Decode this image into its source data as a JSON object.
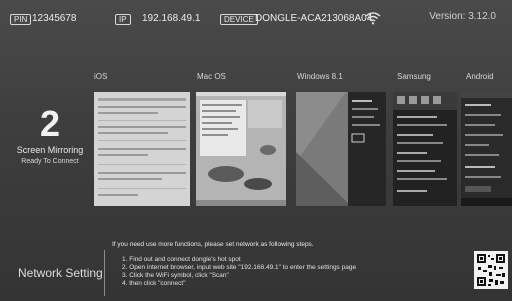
{
  "status": {
    "pin_label": "PIN",
    "pin_value": "12345678",
    "ip_label": "IP",
    "ip_value": "192.168.49.1",
    "device_label": "DEVICE",
    "device_value": "DONGLE-ACA213068A04",
    "wifi_icon": "wifi-icon",
    "version": "Version: 3.12.0"
  },
  "mirroring": {
    "count": "2",
    "title": "Screen Mirroring",
    "status": "Ready To Connect"
  },
  "os_tabs": [
    {
      "label": "iOS"
    },
    {
      "label": "Mac OS"
    },
    {
      "label": "Windows 8.1"
    },
    {
      "label": "Samsung"
    },
    {
      "label": "Android"
    }
  ],
  "network": {
    "title": "Network Setting",
    "intro": "If you need use more functions, please set network as following steps.",
    "steps": [
      "1. Find out and connect dongle's hot spot",
      "2. Open internet browser, input web site \"192.168.49.1\" to enter the settings page",
      "3. Click the WiFi symbol, click \"Scan\"",
      "4. then click \"connect\""
    ],
    "qr_icon": "qr-code-icon"
  }
}
